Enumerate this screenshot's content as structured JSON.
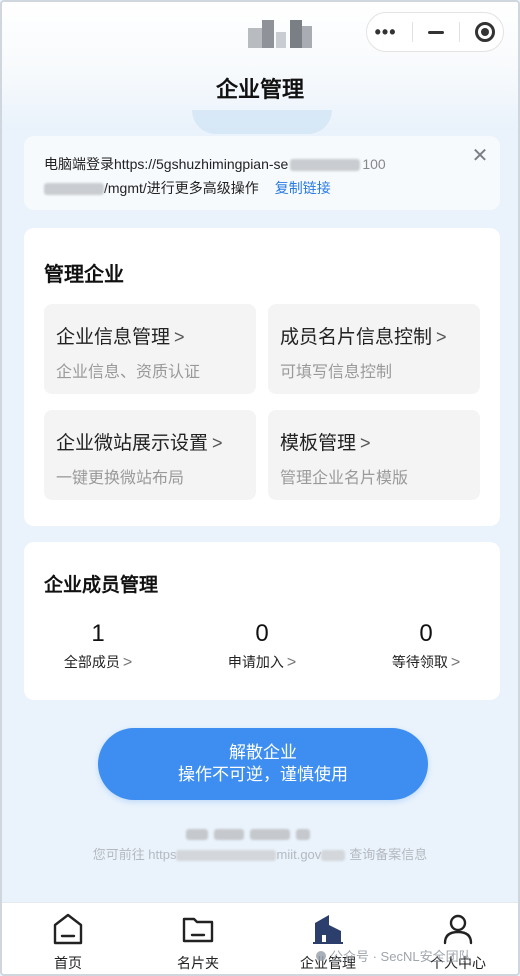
{
  "nav": {
    "title": "企业管理",
    "capsule": {
      "more": "•••"
    }
  },
  "notice": {
    "line1": "电脑端登录https://5gshuzhimingpian-se",
    "line1_tail": "100",
    "line2": "/mgmt/进行更多高级操作",
    "copy": "复制链接",
    "close": "✕"
  },
  "manage": {
    "title": "管理企业",
    "tiles": [
      {
        "title": "企业信息管理",
        "sub": "企业信息、资质认证"
      },
      {
        "title": "成员名片信息控制",
        "sub": "可填写信息控制"
      },
      {
        "title": "企业微站展示设置",
        "sub": "一键更换微站布局"
      },
      {
        "title": "模板管理",
        "sub": "管理企业名片模版"
      }
    ]
  },
  "members": {
    "title": "企业成员管理",
    "stats": [
      {
        "value": "1",
        "label": "全部成员"
      },
      {
        "value": "0",
        "label": "申请加入"
      },
      {
        "value": "0",
        "label": "等待领取"
      }
    ]
  },
  "dissolve": {
    "line1": "解散企业",
    "line2": "操作不可逆，谨慎使用"
  },
  "footer": {
    "line2_a": "您可前往 https",
    "line2_b": "miit.gov",
    "line2_c": "查询备案信息"
  },
  "tabs": [
    {
      "label": "首页",
      "icon": "home-icon"
    },
    {
      "label": "名片夹",
      "icon": "folder-icon"
    },
    {
      "label": "企业管理",
      "icon": "building-icon"
    },
    {
      "label": "个人中心",
      "icon": "user-icon"
    }
  ],
  "watermark": "公众号 · SecNL安全团队",
  "colors": {
    "accent": "#3d8ef0",
    "link": "#2a7be0",
    "active_icon": "#2c3e6b"
  }
}
